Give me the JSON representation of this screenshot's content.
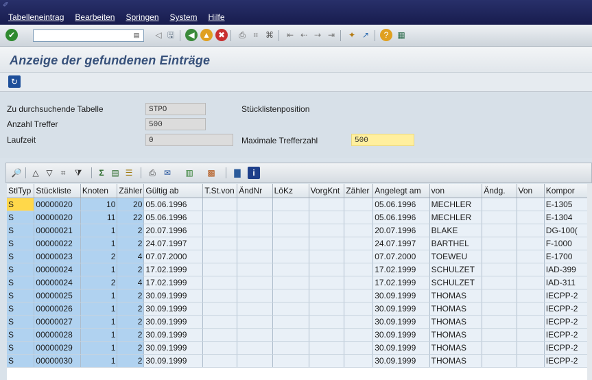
{
  "menu": [
    "Tabelleneintrag",
    "Bearbeiten",
    "Springen",
    "System",
    "Hilfe"
  ],
  "toolbar": {
    "command_placeholder": "",
    "icons": [
      "enter-icon",
      "history-dropdown-icon",
      "back-arrow-icon",
      "save-icon",
      "back-icon",
      "exit-icon",
      "cancel-icon",
      "print-icon",
      "find-icon",
      "find-next-icon",
      "first-page-icon",
      "previous-page-icon",
      "next-page-icon",
      "last-page-icon",
      "new-session-icon",
      "shortcut-icon",
      "help-icon",
      "layout-icon"
    ]
  },
  "title": "Anzeige der gefundenen Einträge",
  "app_toolbar": {
    "refresh_icon": "refresh-icon"
  },
  "form": {
    "table_label": "Zu durchsuchende Tabelle",
    "table_value": "STPO",
    "table_desc": "Stücklistenposition",
    "hits_label": "Anzahl Treffer",
    "hits_value": "500",
    "runtime_label": "Laufzeit",
    "runtime_value": "0",
    "maxhits_label": "Maximale Trefferzahl",
    "maxhits_value": "500"
  },
  "grid_toolbar_icons": [
    "details-icon",
    "sort-ascending-icon",
    "sort-descending-icon",
    "find-icon",
    "filter-icon",
    "sum-icon",
    "subtotal-icon",
    "print-preview-icon",
    "export-icon",
    "mail-icon",
    "abc-analysis-icon",
    "layout-change-icon",
    "graphic-icon",
    "information-icon"
  ],
  "table": {
    "headers": [
      "StlTyp",
      "Stückliste",
      "Knoten",
      "Zähler",
      "Gültig ab",
      "T.St.von",
      "ÄndNr",
      "LöKz",
      "VorgKnt",
      "Zähler",
      "Angelegt am",
      "von",
      "Ändg.",
      "Von",
      "Kompor"
    ],
    "rows": [
      [
        "S",
        "00000020",
        "10",
        "20",
        "05.06.1996",
        "",
        "",
        "",
        "",
        "",
        "05.06.1996",
        "MECHLER",
        "",
        "",
        "E-1305"
      ],
      [
        "S",
        "00000020",
        "11",
        "22",
        "05.06.1996",
        "",
        "",
        "",
        "",
        "",
        "05.06.1996",
        "MECHLER",
        "",
        "",
        "E-1304"
      ],
      [
        "S",
        "00000021",
        "1",
        "2",
        "20.07.1996",
        "",
        "",
        "",
        "",
        "",
        "20.07.1996",
        "BLAKE",
        "",
        "",
        "DG-100("
      ],
      [
        "S",
        "00000022",
        "1",
        "2",
        "24.07.1997",
        "",
        "",
        "",
        "",
        "",
        "24.07.1997",
        "BARTHEL",
        "",
        "",
        "F-1000"
      ],
      [
        "S",
        "00000023",
        "2",
        "4",
        "07.07.2000",
        "",
        "",
        "",
        "",
        "",
        "07.07.2000",
        "TOEWEU",
        "",
        "",
        "E-1700"
      ],
      [
        "S",
        "00000024",
        "1",
        "2",
        "17.02.1999",
        "",
        "",
        "",
        "",
        "",
        "17.02.1999",
        "SCHULZET",
        "",
        "",
        "IAD-399"
      ],
      [
        "S",
        "00000024",
        "2",
        "4",
        "17.02.1999",
        "",
        "",
        "",
        "",
        "",
        "17.02.1999",
        "SCHULZET",
        "",
        "",
        "IAD-311"
      ],
      [
        "S",
        "00000025",
        "1",
        "2",
        "30.09.1999",
        "",
        "",
        "",
        "",
        "",
        "30.09.1999",
        "THOMAS",
        "",
        "",
        "IECPP-2"
      ],
      [
        "S",
        "00000026",
        "1",
        "2",
        "30.09.1999",
        "",
        "",
        "",
        "",
        "",
        "30.09.1999",
        "THOMAS",
        "",
        "",
        "IECPP-2"
      ],
      [
        "S",
        "00000027",
        "1",
        "2",
        "30.09.1999",
        "",
        "",
        "",
        "",
        "",
        "30.09.1999",
        "THOMAS",
        "",
        "",
        "IECPP-2"
      ],
      [
        "S",
        "00000028",
        "1",
        "2",
        "30.09.1999",
        "",
        "",
        "",
        "",
        "",
        "30.09.1999",
        "THOMAS",
        "",
        "",
        "IECPP-2"
      ],
      [
        "S",
        "00000029",
        "1",
        "2",
        "30.09.1999",
        "",
        "",
        "",
        "",
        "",
        "30.09.1999",
        "THOMAS",
        "",
        "",
        "IECPP-2"
      ],
      [
        "S",
        "00000030",
        "1",
        "2",
        "30.09.1999",
        "",
        "",
        "",
        "",
        "",
        "30.09.1999",
        "THOMAS",
        "",
        "",
        "IECPP-2"
      ]
    ]
  }
}
